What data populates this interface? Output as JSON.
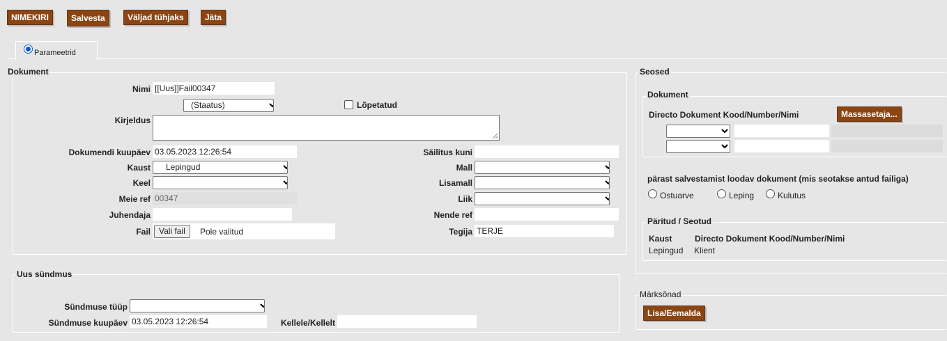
{
  "toolbar": {
    "list_label": "NIMEKIRI",
    "save_label": "Salvesta",
    "clear_label": "Väljad tühjaks",
    "leave_label": "Jäta"
  },
  "tabs": {
    "parameters": "Parameetrid"
  },
  "dokument": {
    "legend": "Dokument",
    "name_label": "Nimi",
    "name_value": "[[Uus]]Fail00347",
    "status_value": "(Staatus)",
    "finished_label": "Lõpetatud",
    "description_label": "Kirjeldus",
    "description_value": "",
    "doc_date_label": "Dokumendi kuupäev",
    "doc_date_value": "03.05.2023 12:26:54",
    "keep_until_label": "Säilitus kuni",
    "keep_until_value": "",
    "folder_label": "Kaust",
    "folder_value": "Lepingud",
    "template_label": "Mall",
    "template_value": "",
    "language_label": "Keel",
    "language_value": "",
    "extra_template_label": "Lisamall",
    "extra_template_value": "",
    "our_ref_label": "Meie ref",
    "our_ref_value": "00347",
    "type_label": "Liik",
    "type_value": "",
    "supervisor_label": "Juhendaja",
    "supervisor_value": "",
    "their_ref_label": "Nende ref",
    "their_ref_value": "",
    "file_label": "Fail",
    "file_button": "Vali fail",
    "file_status": "Pole valitud",
    "creator_label": "Tegija",
    "creator_value": "TERJE"
  },
  "event": {
    "legend": "Uus sündmus",
    "type_label": "Sündmuse tüüp",
    "type_value": "",
    "date_label": "Sündmuse kuupäev",
    "date_value": "03.05.2023 12:26:54",
    "to_from_label": "Kellele/Kellelt",
    "to_from_value": ""
  },
  "relations": {
    "legend": "Seosed",
    "doc_legend": "Dokument",
    "doc_header": "Directo Dokument Kood/Number/Nimi",
    "bulk_button": "Massasetaja...",
    "after_save_label": "pärast salvestamist loodav dokument (mis seotakse antud failiga)",
    "after_save_options": [
      "Ostuarve",
      "Leping",
      "Kulutus"
    ],
    "linked_legend": "Päritud / Seotud",
    "linked_col_folder": "Kaust",
    "linked_col_doc": "Directo Dokument Kood/Number/Nimi",
    "linked_row_folder": "Lepingud",
    "linked_row_doc": "Klient"
  },
  "keywords": {
    "legend": "Märksõnad",
    "button": "Lisa/Eemalda"
  },
  "colors": {
    "accent": "#8b4513",
    "background": "#e6e6e6"
  }
}
